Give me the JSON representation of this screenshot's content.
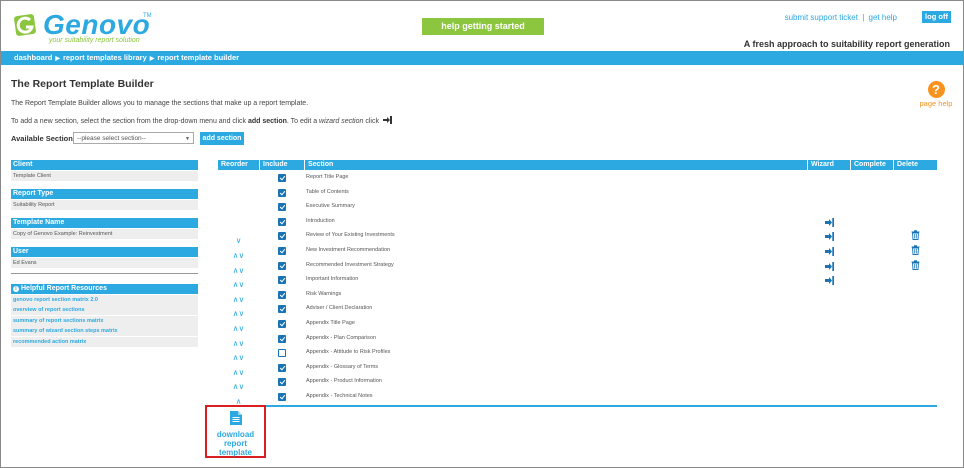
{
  "header": {
    "logo_text": "Genovo",
    "logo_tm": "TM",
    "logo_tagline": "your suitability report solution",
    "help_button": "help getting started",
    "top_links": {
      "support": "submit support ticket",
      "separator": "|",
      "help": "get help"
    },
    "logoff": "log off",
    "tagline": "A fresh approach to suitability report generation"
  },
  "breadcrumb": [
    "dashboard",
    "report templates library",
    "report template builder"
  ],
  "page": {
    "title": "The Report Template Builder",
    "intro1": "The Report Template Builder allows you to manage the sections that make up a report template.",
    "intro2_a": "To add a new section, select the section from the drop-down menu and click ",
    "intro2_b": "add section",
    "intro2_c": ". To edit a ",
    "intro2_d": "wizard section",
    "intro2_e": " click",
    "page_help": "page help",
    "available_label": "Available Sections:",
    "select_value": "--please select section--",
    "add_button": "add section"
  },
  "sidebar": {
    "client_hd": "Client",
    "client_val": "Template Client",
    "type_hd": "Report Type",
    "type_val": "Suitability Report",
    "tname_hd": "Template Name",
    "tname_val": "Copy of Genovo Example: Reinvestment",
    "user_hd": "User",
    "user_val": "Ed Evans",
    "resources_hd": "Helpful Report Resources",
    "resources": [
      "genovo report section matrix 2.0",
      "overview of report sections",
      "summary of report sections matrix",
      "summary of wizard section steps matrix",
      "recommended action matrix"
    ]
  },
  "table": {
    "headers": {
      "reorder": "Reorder",
      "include": "Include",
      "section": "Section",
      "wizard": "Wizard",
      "complete": "Complete",
      "delete": "Delete"
    },
    "rows": [
      {
        "name": "Report Title Page",
        "reorder": "",
        "checked": true,
        "wizard": false,
        "delete": false
      },
      {
        "name": "Table of Contents",
        "reorder": "",
        "checked": true,
        "wizard": false,
        "delete": false
      },
      {
        "name": "Executive Summary",
        "reorder": "",
        "checked": true,
        "wizard": false,
        "delete": false
      },
      {
        "name": "Introduction",
        "reorder": "",
        "checked": true,
        "wizard": true,
        "delete": false
      },
      {
        "name": "Review of Your Existing Investments",
        "reorder": "∨",
        "checked": true,
        "wizard": true,
        "delete": true
      },
      {
        "name": "New Investment Recommendation",
        "reorder": "∧∨",
        "checked": true,
        "wizard": true,
        "delete": true
      },
      {
        "name": "Recommended Investment Strategy",
        "reorder": "∧∨",
        "checked": true,
        "wizard": true,
        "delete": true
      },
      {
        "name": "Important Information",
        "reorder": "∧∨",
        "checked": true,
        "wizard": true,
        "delete": false
      },
      {
        "name": "Risk Warnings",
        "reorder": "∧∨",
        "checked": true,
        "wizard": false,
        "delete": false
      },
      {
        "name": "Adviser / Client Declaration",
        "reorder": "∧∨",
        "checked": true,
        "wizard": false,
        "delete": false
      },
      {
        "name": "Appendix Title Page",
        "reorder": "∧∨",
        "checked": true,
        "wizard": false,
        "delete": false
      },
      {
        "name": "Appendix - Plan Comparison",
        "reorder": "∧∨",
        "checked": true,
        "wizard": false,
        "delete": false
      },
      {
        "name": "Appendix - Attitude to Risk Profiles",
        "reorder": "∧∨",
        "checked": false,
        "wizard": false,
        "delete": false
      },
      {
        "name": "Appendix - Glossary of Terms",
        "reorder": "∧∨",
        "checked": true,
        "wizard": false,
        "delete": false
      },
      {
        "name": "Appendix - Product Information",
        "reorder": "∧∨",
        "checked": true,
        "wizard": false,
        "delete": false
      },
      {
        "name": "Appendix - Technical Notes",
        "reorder": "∧",
        "checked": true,
        "wizard": false,
        "delete": false
      }
    ]
  },
  "download": {
    "line1": "download",
    "line2": "report",
    "line3": "template"
  },
  "colors": {
    "accent": "#2ca9e1",
    "green": "#8cc63f",
    "orange": "#f7931e",
    "highlight": "#d81e1e"
  }
}
